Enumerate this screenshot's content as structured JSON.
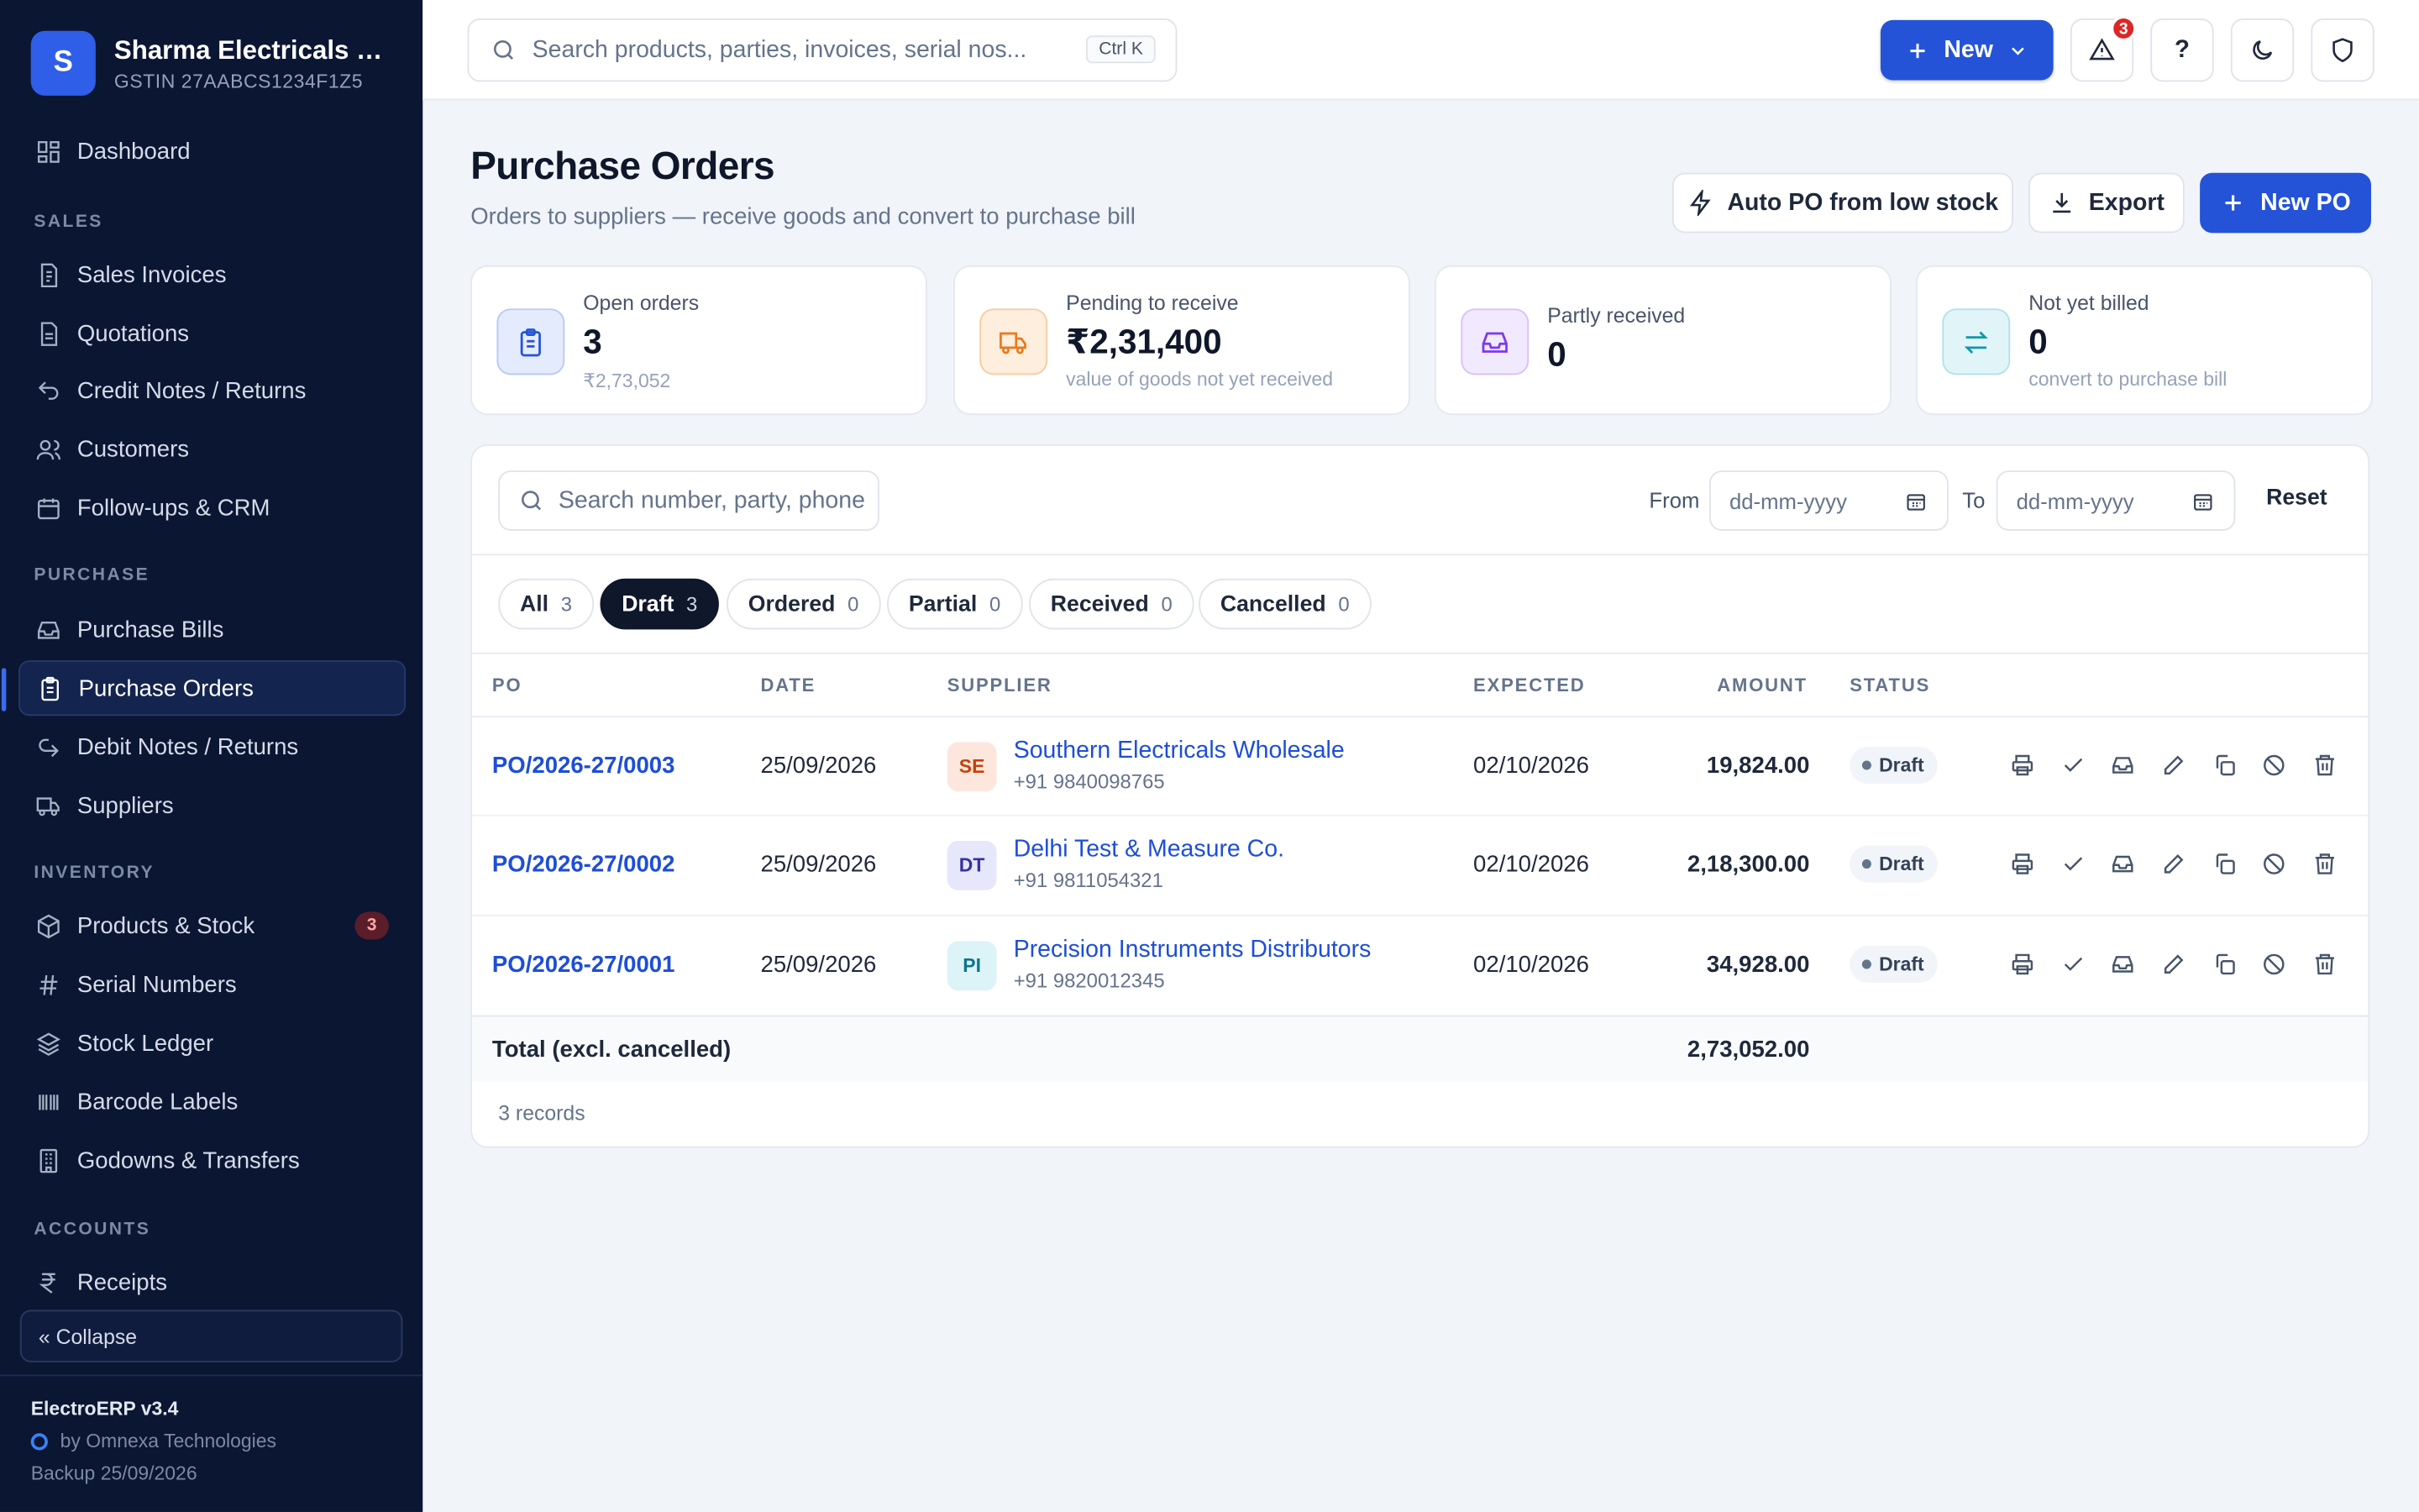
{
  "brand": {
    "initial": "S",
    "name": "Sharma Electricals & Instruments",
    "gstin": "GSTIN 27AABCS1234F1Z5"
  },
  "sidebar": {
    "dashboard": "Dashboard",
    "sections": {
      "sales": "SALES",
      "purchase": "PURCHASE",
      "inventory": "INVENTORY",
      "accounts": "ACCOUNTS"
    },
    "sales_items": [
      "Sales Invoices",
      "Quotations",
      "Credit Notes / Returns",
      "Customers",
      "Follow-ups & CRM"
    ],
    "purchase_items": [
      "Purchase Bills",
      "Purchase Orders",
      "Debit Notes / Returns",
      "Suppliers"
    ],
    "inventory_items": [
      "Products & Stock",
      "Serial Numbers",
      "Stock Ledger",
      "Barcode Labels",
      "Godowns & Transfers"
    ],
    "products_badge": "3",
    "accounts_items": [
      "Receipts"
    ],
    "collapse": "« Collapse",
    "footer": {
      "version": "ElectroERP v3.4",
      "by": "by Omnexa Technologies",
      "backup": "Backup 25/09/2026"
    }
  },
  "topbar": {
    "search_placeholder": "Search products, parties, invoices, serial nos...",
    "shortcut": "Ctrl K",
    "new_label": "New",
    "alerts_count": "3",
    "help": "?"
  },
  "page": {
    "title": "Purchase Orders",
    "subtitle": "Orders to suppliers — receive goods and convert to purchase bill",
    "actions": {
      "auto_po": "Auto PO from low stock",
      "export": "Export",
      "new_po": "New PO"
    }
  },
  "kpis": [
    {
      "label": "Open orders",
      "value": "3",
      "note": "₹2,73,052"
    },
    {
      "label": "Pending to receive",
      "value": "₹2,31,400",
      "note": "value of goods not yet received"
    },
    {
      "label": "Partly received",
      "value": "0",
      "note": ""
    },
    {
      "label": "Not yet billed",
      "value": "0",
      "note": "convert to purchase bill"
    }
  ],
  "filters": {
    "search_placeholder": "Search number, party, phone",
    "from_label": "From",
    "to_label": "To",
    "date_placeholder": "dd-mm-yyyy",
    "reset": "Reset"
  },
  "tabs": [
    {
      "label": "All",
      "count": "3"
    },
    {
      "label": "Draft",
      "count": "3"
    },
    {
      "label": "Ordered",
      "count": "0"
    },
    {
      "label": "Partial",
      "count": "0"
    },
    {
      "label": "Received",
      "count": "0"
    },
    {
      "label": "Cancelled",
      "count": "0"
    }
  ],
  "table": {
    "columns": {
      "po": "PO",
      "date": "DATE",
      "supplier": "SUPPLIER",
      "expected": "EXPECTED",
      "amount": "AMOUNT",
      "status": "STATUS"
    },
    "rows": [
      {
        "po": "PO/2026-27/0003",
        "date": "25/09/2026",
        "initials": "SE",
        "supplier": "Southern Electricals Wholesale",
        "phone": "+91 9840098765",
        "expected": "02/10/2026",
        "amount": "19,824.00",
        "status": "Draft"
      },
      {
        "po": "PO/2026-27/0002",
        "date": "25/09/2026",
        "initials": "DT",
        "supplier": "Delhi Test & Measure Co.",
        "phone": "+91 9811054321",
        "expected": "02/10/2026",
        "amount": "2,18,300.00",
        "status": "Draft"
      },
      {
        "po": "PO/2026-27/0001",
        "date": "25/09/2026",
        "initials": "PI",
        "supplier": "Precision Instruments Distributors",
        "phone": "+91 9820012345",
        "expected": "02/10/2026",
        "amount": "34,928.00",
        "status": "Draft"
      }
    ],
    "total_label": "Total (excl. cancelled)",
    "total_amount": "2,73,052.00",
    "records": "3 records"
  },
  "colors": {
    "sidebar": "#0b1633",
    "primary": "#2453d8",
    "link": "#1d4ed8"
  }
}
